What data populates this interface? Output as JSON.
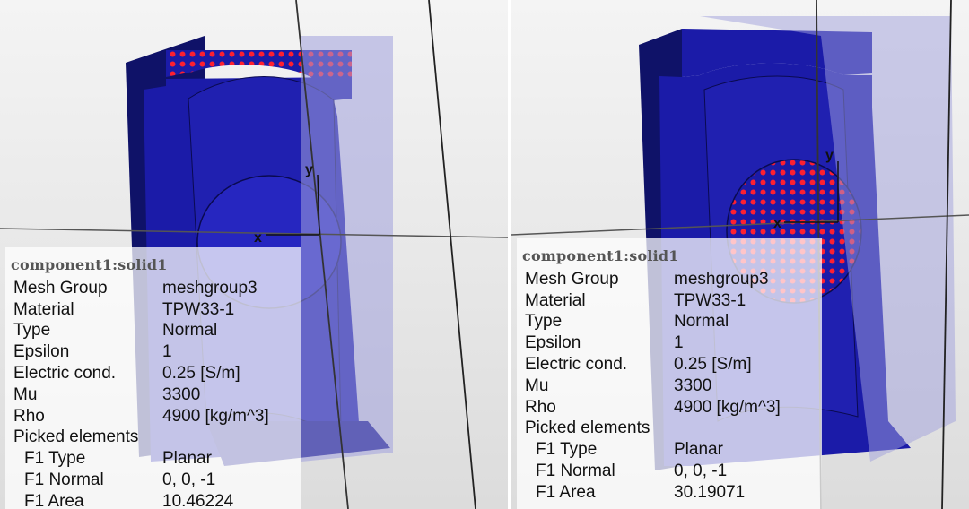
{
  "views": [
    {
      "id": "left",
      "axes": {
        "x": "x",
        "y": "y"
      },
      "info_panel": {
        "title": "component1:solid1",
        "rows": [
          {
            "key": "Mesh Group",
            "value": "meshgroup3"
          },
          {
            "key": "Material",
            "value": "TPW33-1"
          },
          {
            "key": "Type",
            "value": "Normal"
          },
          {
            "key": "Epsilon",
            "value": "1"
          },
          {
            "key": "Electric cond.",
            "value": "0.25 [S/m]"
          },
          {
            "key": "Mu",
            "value": "3300"
          },
          {
            "key": "Rho",
            "value": "4900 [kg/m^3]"
          },
          {
            "key": "Picked elements",
            "value": ""
          }
        ],
        "picked": [
          {
            "key": "F1 Type",
            "value": "Planar"
          },
          {
            "key": "F1 Normal",
            "value": "0, 0, -1"
          },
          {
            "key": "F1 Area",
            "value": "10.46224"
          }
        ]
      }
    },
    {
      "id": "right",
      "axes": {
        "x": "x",
        "y": "y"
      },
      "info_panel": {
        "title": "component1:solid1",
        "rows": [
          {
            "key": "Mesh Group",
            "value": "meshgroup3"
          },
          {
            "key": "Material",
            "value": "TPW33-1"
          },
          {
            "key": "Type",
            "value": "Normal"
          },
          {
            "key": "Epsilon",
            "value": "1"
          },
          {
            "key": "Electric cond.",
            "value": "0.25 [S/m]"
          },
          {
            "key": "Mu",
            "value": "3300"
          },
          {
            "key": "Rho",
            "value": "4900 [kg/m^3]"
          },
          {
            "key": "Picked elements",
            "value": ""
          }
        ],
        "picked": [
          {
            "key": "F1 Type",
            "value": "Planar"
          },
          {
            "key": "F1 Normal",
            "value": "0, 0, -1"
          },
          {
            "key": "F1 Area",
            "value": "30.19071"
          }
        ]
      }
    }
  ],
  "colors": {
    "solid": "#1b1ba8",
    "solid_dark": "#0f1268",
    "transparent_body": "#9a9ad8",
    "picked_face": "#ff2030",
    "background": "#e8e8e8"
  }
}
